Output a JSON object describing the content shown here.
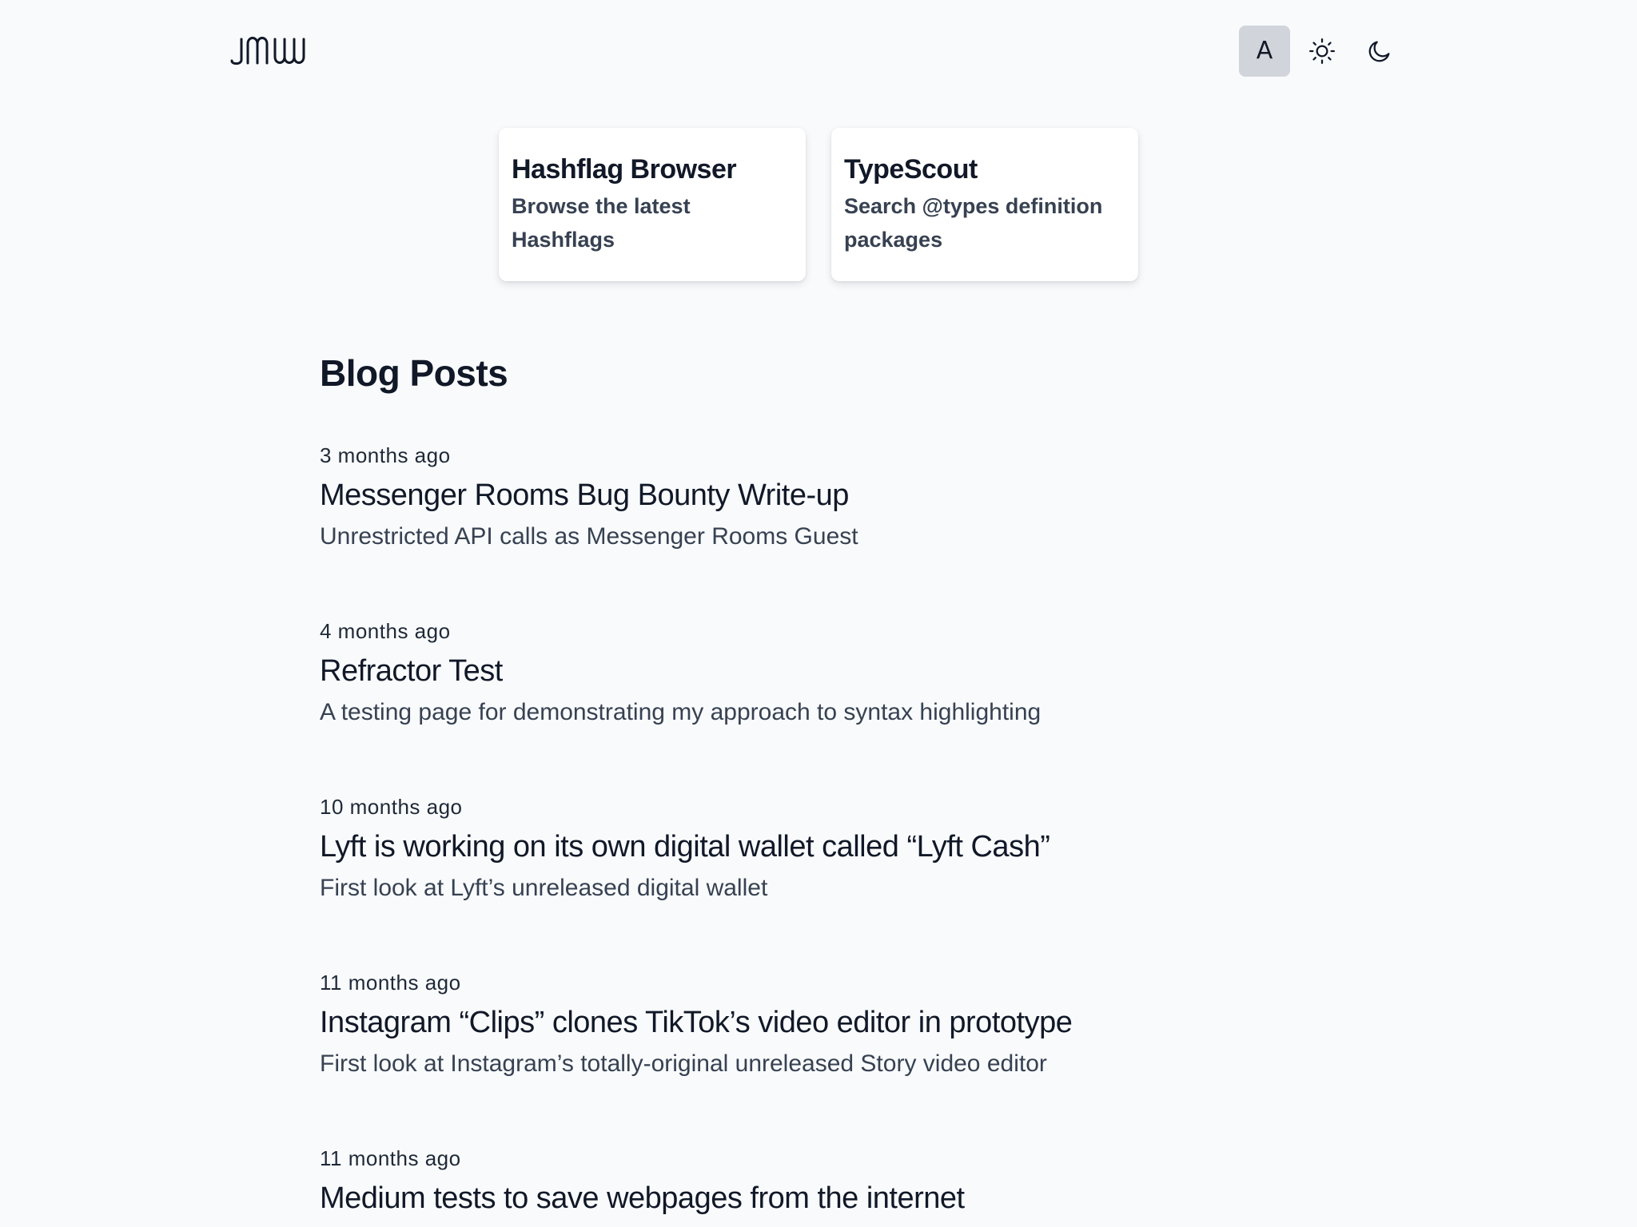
{
  "header": {
    "logo_label": "JMW",
    "theme_options": [
      {
        "label": "A",
        "icon": "auto-theme-icon",
        "active": true
      },
      {
        "label": "",
        "icon": "sun-icon",
        "active": false
      },
      {
        "label": "",
        "icon": "moon-icon",
        "active": false
      }
    ]
  },
  "projects": [
    {
      "title": "Hashflag Browser",
      "description": "Browse the latest Hashflags"
    },
    {
      "title": "TypeScout",
      "description": "Search @types definition packages"
    }
  ],
  "blog": {
    "heading": "Blog Posts",
    "posts": [
      {
        "date": "3 months ago",
        "title": "Messenger Rooms Bug Bounty Write-up",
        "description": "Unrestricted API calls as Messenger Rooms Guest"
      },
      {
        "date": "4 months ago",
        "title": "Refractor Test",
        "description": "A testing page for demonstrating my approach to syntax highlighting"
      },
      {
        "date": "10 months ago",
        "title": "Lyft is working on its own digital wallet called “Lyft Cash”",
        "description": "First look at Lyft’s unreleased digital wallet"
      },
      {
        "date": "11 months ago",
        "title": "Instagram “Clips” clones TikTok’s video editor in prototype",
        "description": "First look at Instagram’s totally-original unreleased Story video editor"
      },
      {
        "date": "11 months ago",
        "title": "Medium tests to save webpages from the internet",
        "description": ""
      }
    ]
  },
  "colors": {
    "background": "#f8fafc",
    "text": "#111827",
    "muted": "#374151",
    "active_toggle": "#d1d5db"
  }
}
